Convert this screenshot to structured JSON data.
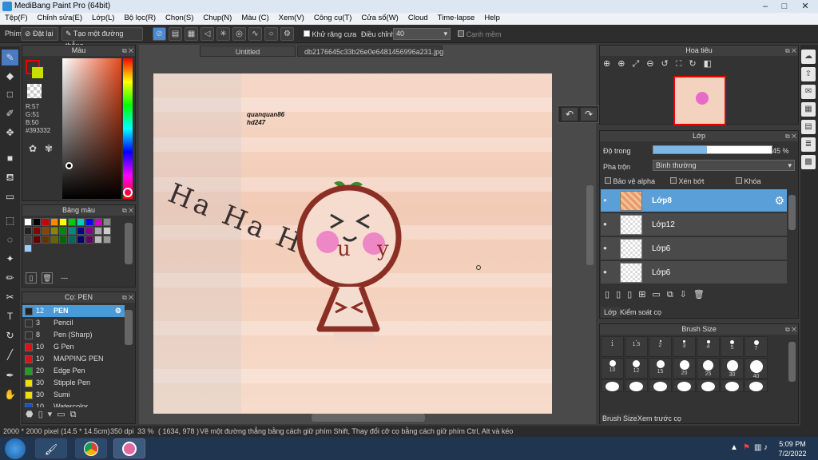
{
  "window": {
    "title": "MediBang Paint Pro (64bit)"
  },
  "menu": [
    "Tệp(F)",
    "Chỉnh sửa(E)",
    "Lớp(L)",
    "Bộ lọc(R)",
    "Chọn(S)",
    "Chụp(N)",
    "Màu (C)",
    "Xem(V)",
    "Công cụ(T)",
    "Cửa sổ(W)",
    "Cloud",
    "Time-lapse",
    "Help"
  ],
  "toolbar": {
    "label": "Phím",
    "reset": "Đặt lại",
    "straight_line": "Tạo một đường thẳng",
    "antialias": "Khử răng cưa",
    "adjust": "Điều chỉnh",
    "adjust_value": "40",
    "edge": "Cạnh mềm"
  },
  "color_panel": {
    "title": "Màu",
    "r": "R:57",
    "g": "G:51",
    "b": "B:50",
    "hex": "#393332"
  },
  "palette_panel": {
    "title": "Bảng màu",
    "footer": "---"
  },
  "brush_list": {
    "title": "Cọ: PEN",
    "items": [
      {
        "size": "12",
        "name": "PEN",
        "color": "#222222"
      },
      {
        "size": "3",
        "name": "Pencil",
        "color": "#333333"
      },
      {
        "size": "8",
        "name": "Pen (Sharp)",
        "color": "#333333"
      },
      {
        "size": "10",
        "name": "G Pen",
        "color": "#e01010"
      },
      {
        "size": "10",
        "name": "MAPPING PEN",
        "color": "#e01010"
      },
      {
        "size": "20",
        "name": "Edge Pen",
        "color": "#1fa01f"
      },
      {
        "size": "30",
        "name": "Stipple Pen",
        "color": "#f0e000"
      },
      {
        "size": "30",
        "name": "Sumi",
        "color": "#f0e000"
      },
      {
        "size": "10",
        "name": "Watercolor",
        "color": "#1a4fd0"
      }
    ]
  },
  "tabs": [
    "Untitled",
    "db2176645c33b26e0e6481456996a231.jpg"
  ],
  "canvas": {
    "credit1": "quanquan86",
    "credit2": "hd247",
    "handwriting": "Ha Ha Ha",
    "chars": [
      "u",
      "y"
    ]
  },
  "navigator": {
    "title": "Hoa tiêu"
  },
  "layers": {
    "title": "Lớp",
    "opacity_label": "Độ trong",
    "opacity_value": "45 %",
    "opacity": 0.45,
    "blend_label": "Pha trộn",
    "blend_value": "Bình thường",
    "protect_alpha": "Bảo vệ alpha",
    "clip": "Xén bớt",
    "lock": "Khóa",
    "items": [
      "Lớp8",
      "Lớp12",
      "Lớp6",
      "Lớp6"
    ],
    "tab1": "Lớp",
    "tab2": "Kiểm soát cọ"
  },
  "brush_size": {
    "title": "Brush Size",
    "row1": [
      "1",
      "1.5",
      "2",
      "3",
      "4",
      "5",
      "7"
    ],
    "row2": [
      "10",
      "12",
      "15",
      "20",
      "25",
      "30",
      "40"
    ],
    "tab1": "Brush Size",
    "tab2": "Xem trước cọ"
  },
  "status": {
    "size": "2000 * 2000 pixel",
    "dims": "(14.5 * 14.5cm)",
    "dpi": "350 dpi",
    "zoom": "33 %",
    "coords": "( 1634, 978 )",
    "hint": "Vẽ một đường thẳng bằng cách giữ phím Shift, Thay đổi cỡ cọ bằng cách giữ phím Ctrl, Alt và kéo"
  },
  "taskbar": {
    "time": "5:09 PM",
    "date": "7/2/2022"
  },
  "colors": {
    "accent": "#4a9ad8",
    "layer_selected": "#5a9fd8"
  }
}
